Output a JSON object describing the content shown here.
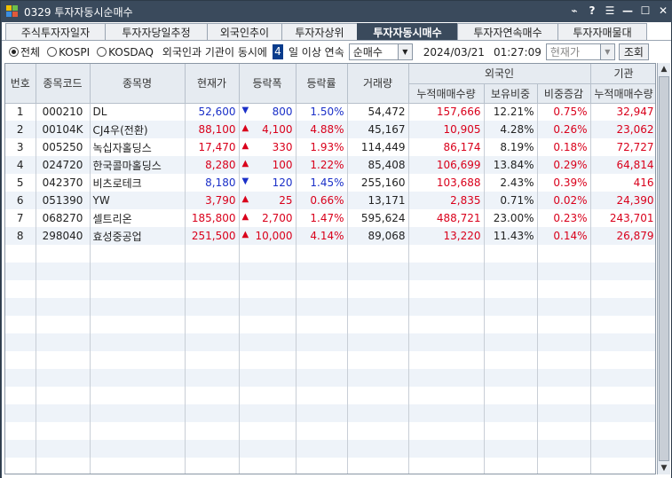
{
  "window": {
    "title": "0329 투자자동시순매수",
    "buttons": [
      "⌁",
      "?",
      "☰",
      "—",
      "☐",
      "✕"
    ]
  },
  "tabs": [
    "주식투자자일자",
    "투자자당일추정",
    "외국인추이",
    "투자자상위",
    "투자자동시매수",
    "투자자연속매수",
    "투자자매물대"
  ],
  "active_tab": 4,
  "filters": {
    "all": "전체",
    "kospi": "KOSPI",
    "kosdaq": "KOSDAQ",
    "text1": "외국인과 기관이 동시에",
    "days": "4",
    "text2": "일 이상 연속",
    "mode": "순매수",
    "date": "2024/03/21",
    "time": "01:27:09",
    "price_type": "현재가",
    "search": "조회"
  },
  "headers": {
    "no": "번호",
    "code": "종목코드",
    "name": "종목명",
    "price": "현재가",
    "change": "등락폭",
    "rate": "등락률",
    "volume": "거래량",
    "foreign": "외국인",
    "f_cum": "누적매매수량",
    "f_hold": "보유비중",
    "f_delta": "비중증감",
    "inst": "기관",
    "i_cum": "누적매매수량"
  },
  "rows": [
    {
      "no": "1",
      "code": "000210",
      "name": "DL",
      "price": "52,600",
      "dir": "down",
      "change": "800",
      "rate": "1.50%",
      "volume": "54,472",
      "f_cum": "157,666",
      "f_hold": "12.21%",
      "f_delta": "0.75%",
      "i_cum": "32,947"
    },
    {
      "no": "2",
      "code": "00104K",
      "name": "CJ4우(전환)",
      "price": "88,100",
      "dir": "up",
      "change": "4,100",
      "rate": "4.88%",
      "volume": "45,167",
      "f_cum": "10,905",
      "f_hold": "4.28%",
      "f_delta": "0.26%",
      "i_cum": "23,062"
    },
    {
      "no": "3",
      "code": "005250",
      "name": "녹십자홀딩스",
      "price": "17,470",
      "dir": "up",
      "change": "330",
      "rate": "1.93%",
      "volume": "114,449",
      "f_cum": "86,174",
      "f_hold": "8.19%",
      "f_delta": "0.18%",
      "i_cum": "72,727"
    },
    {
      "no": "4",
      "code": "024720",
      "name": "한국콜마홀딩스",
      "price": "8,280",
      "dir": "up",
      "change": "100",
      "rate": "1.22%",
      "volume": "85,408",
      "f_cum": "106,699",
      "f_hold": "13.84%",
      "f_delta": "0.29%",
      "i_cum": "64,814"
    },
    {
      "no": "5",
      "code": "042370",
      "name": "비츠로테크",
      "price": "8,180",
      "dir": "down",
      "change": "120",
      "rate": "1.45%",
      "volume": "255,160",
      "f_cum": "103,688",
      "f_hold": "2.43%",
      "f_delta": "0.39%",
      "i_cum": "416"
    },
    {
      "no": "6",
      "code": "051390",
      "name": "YW",
      "price": "3,790",
      "dir": "up",
      "change": "25",
      "rate": "0.66%",
      "volume": "13,171",
      "f_cum": "2,835",
      "f_hold": "0.71%",
      "f_delta": "0.02%",
      "i_cum": "24,390"
    },
    {
      "no": "7",
      "code": "068270",
      "name": "셀트리온",
      "price": "185,800",
      "dir": "up",
      "change": "2,700",
      "rate": "1.47%",
      "volume": "595,624",
      "f_cum": "488,721",
      "f_hold": "23.00%",
      "f_delta": "0.23%",
      "i_cum": "243,701"
    },
    {
      "no": "8",
      "code": "298040",
      "name": "효성중공업",
      "price": "251,500",
      "dir": "up",
      "change": "10,000",
      "rate": "4.14%",
      "volume": "89,068",
      "f_cum": "13,220",
      "f_hold": "11.43%",
      "f_delta": "0.14%",
      "i_cum": "26,879"
    }
  ],
  "colors": {
    "up": "#d9001b",
    "down": "#1b30c8",
    "titlebar": "#3a4a5c",
    "even_row": "#eef3f9"
  }
}
